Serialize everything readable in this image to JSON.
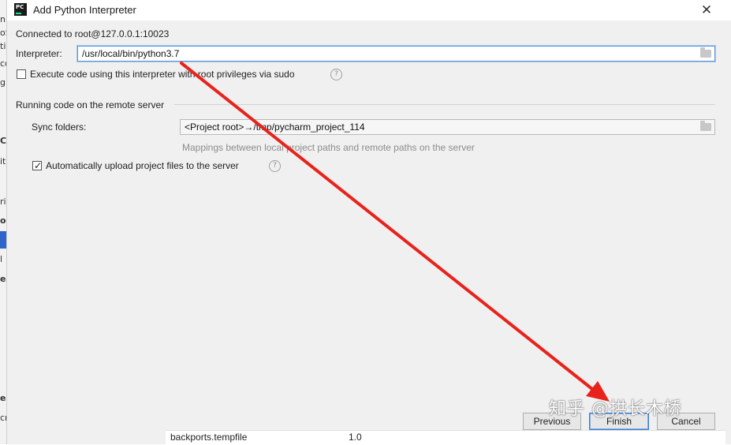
{
  "window": {
    "title": "Add Python Interpreter",
    "app_icon_text": "PC",
    "close_glyph": "✕"
  },
  "background_fragments": [
    "n",
    "oS",
    "ti",
    "co",
    "g",
    "Co",
    "iti",
    "ri",
    "ou",
    "l",
    "el",
    "e",
    "cr"
  ],
  "connection": {
    "text": "Connected to root@127.0.0.1:10023"
  },
  "interpreter": {
    "label": "Interpreter:",
    "value": "/usr/local/bin/python3.7",
    "browse_icon": "folder-icon"
  },
  "sudo_option": {
    "label": "Execute code using this interpreter with root privileges via sudo",
    "checked": false,
    "help_glyph": "?"
  },
  "remote_section": {
    "title": "Running code on the remote server",
    "sync_label": "Sync folders:",
    "sync_value": "<Project root>→/tmp/pycharm_project_114",
    "sync_hint": "Mappings between local project paths and remote paths on the server",
    "auto_upload_label": "Automatically upload project files to the server",
    "auto_upload_checked": true,
    "help_glyph": "?"
  },
  "background_table": {
    "package": "backports.tempfile",
    "version": "1.0"
  },
  "buttons": {
    "previous": "Previous",
    "finish": "Finish",
    "cancel": "Cancel"
  },
  "watermark": "知乎 @拱长木桥",
  "annotation": {
    "arrow_color": "#e8231b"
  }
}
